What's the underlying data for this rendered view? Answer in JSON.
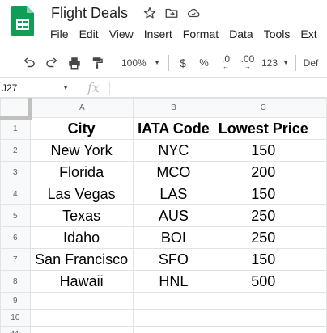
{
  "app": {
    "doc_title": "Flight Deals",
    "menu": [
      "File",
      "Edit",
      "View",
      "Insert",
      "Format",
      "Data",
      "Tools",
      "Ext"
    ]
  },
  "toolbar": {
    "zoom": "100%",
    "currency": "$",
    "percent": "%",
    "dec_decrease": ".0",
    "dec_increase": ".00",
    "more_formats": "123",
    "font": "Def"
  },
  "formula_bar": {
    "cell_ref": "J27",
    "fx": "fx"
  },
  "sheet": {
    "columns": [
      "A",
      "B",
      "C"
    ],
    "rows": [
      {
        "num": "1",
        "cells": [
          "City",
          "IATA Code",
          "Lowest Price"
        ]
      },
      {
        "num": "2",
        "cells": [
          "New York",
          "NYC",
          "150"
        ]
      },
      {
        "num": "3",
        "cells": [
          "Florida",
          "MCO",
          "200"
        ]
      },
      {
        "num": "4",
        "cells": [
          "Las Vegas",
          "LAS",
          "150"
        ]
      },
      {
        "num": "5",
        "cells": [
          "Texas",
          "AUS",
          "250"
        ]
      },
      {
        "num": "6",
        "cells": [
          "Idaho",
          "BOI",
          "250"
        ]
      },
      {
        "num": "7",
        "cells": [
          "San Francisco",
          "SFO",
          "150"
        ]
      },
      {
        "num": "8",
        "cells": [
          "Hawaii",
          "HNL",
          "500"
        ]
      },
      {
        "num": "9",
        "cells": [
          "",
          "",
          ""
        ]
      },
      {
        "num": "10",
        "cells": [
          "",
          "",
          ""
        ]
      },
      {
        "num": "11",
        "cells": [
          "",
          "",
          ""
        ]
      }
    ]
  },
  "colors": {
    "sheets_green": "#0f9d58",
    "header_bg": "#f8f9fa",
    "grid_line": "#e2e3e3"
  }
}
